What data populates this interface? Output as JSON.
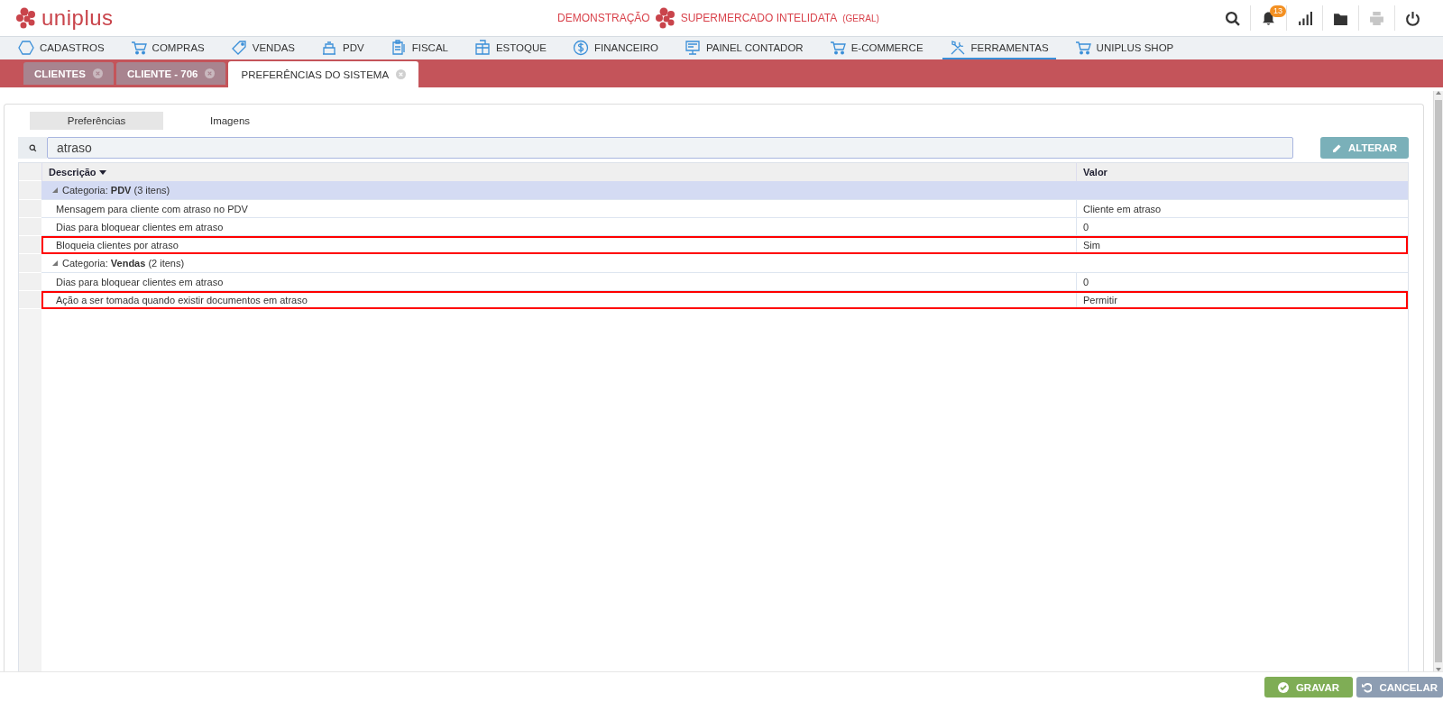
{
  "header": {
    "logo_text": "uniplus",
    "mode": "DEMONSTRAÇÃO",
    "company": "SUPERMERCADO INTELIDATA",
    "scope": "(GERAL)",
    "toolbar": [
      {
        "kind": "search",
        "disabled": false
      },
      {
        "kind": "bell",
        "disabled": false,
        "badge": "13"
      },
      {
        "kind": "chart",
        "disabled": false
      },
      {
        "kind": "folder",
        "disabled": false
      },
      {
        "kind": "printer",
        "disabled": true
      },
      {
        "kind": "power",
        "disabled": false
      }
    ]
  },
  "menu": [
    {
      "kind": "hexagon",
      "label": "CADASTROS",
      "selected": false
    },
    {
      "kind": "cart",
      "label": "COMPRAS",
      "selected": false
    },
    {
      "kind": "tag",
      "label": "VENDAS",
      "selected": false
    },
    {
      "kind": "register",
      "label": "PDV",
      "selected": false
    },
    {
      "kind": "clipboard",
      "label": "FISCAL",
      "selected": false
    },
    {
      "kind": "box",
      "label": "ESTOQUE",
      "selected": false
    },
    {
      "kind": "dollar",
      "label": "FINANCEIRO",
      "selected": false
    },
    {
      "kind": "monitor",
      "label": "PAINEL CONTADOR",
      "selected": false
    },
    {
      "kind": "cart",
      "label": "E-COMMERCE",
      "selected": false
    },
    {
      "kind": "tools",
      "label": "FERRAMENTAS",
      "selected": true
    },
    {
      "kind": "cart",
      "label": "UNIPLUS SHOP",
      "selected": false
    }
  ],
  "doc_tabs": [
    {
      "label": "CLIENTES",
      "selected": false
    },
    {
      "label": "CLIENTE - 706",
      "selected": false
    },
    {
      "label": "PREFERÊNCIAS DO SISTEMA",
      "selected": true
    }
  ],
  "sub_tabs": [
    {
      "label": "Preferências",
      "selected": true
    },
    {
      "label": "Imagens",
      "selected": false
    }
  ],
  "search": {
    "value": "atraso"
  },
  "alter_button": "ALTERAR",
  "table": {
    "columns": [
      {
        "label": "Descrição",
        "sorted": true
      },
      {
        "label": "Valor",
        "sorted": false
      }
    ],
    "groups": [
      {
        "label": "Categoria: **PDV** (3 itens)",
        "expanded": true,
        "selected": true,
        "rows": [
          {
            "description": "Mensagem para cliente com atraso no PDV",
            "value": "Cliente em atraso",
            "highlighted": false
          },
          {
            "description": "Dias para bloquear clientes em atraso",
            "value": "0",
            "highlighted": false
          },
          {
            "description": "Bloqueia clientes por atraso",
            "value": "Sim",
            "highlighted": true
          }
        ]
      },
      {
        "label": "Categoria: **Vendas** (2 itens)",
        "expanded": true,
        "selected": false,
        "rows": [
          {
            "description": "Dias para bloquear clientes em atraso",
            "value": "0",
            "highlighted": false
          },
          {
            "description": "Ação a ser tomada quando existir documentos em atraso",
            "value": "Permitir",
            "highlighted": true
          }
        ]
      }
    ]
  },
  "footer_buttons": [
    {
      "kind": "save",
      "label": "GRAVAR"
    },
    {
      "kind": "cancel",
      "label": "CANCELAR"
    }
  ]
}
